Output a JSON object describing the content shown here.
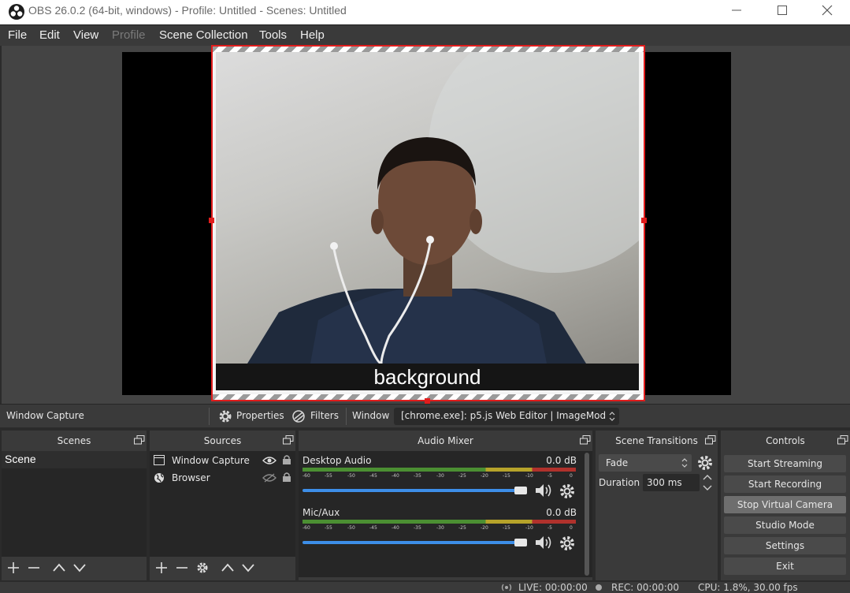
{
  "window": {
    "title": "OBS 26.0.2 (64-bit, windows) - Profile: Untitled - Scenes: Untitled",
    "app_icon": "obs-logo-icon",
    "controls": [
      "minimize-icon",
      "maximize-icon",
      "close-icon"
    ]
  },
  "menu": {
    "file": "File",
    "edit": "Edit",
    "view": "View",
    "profile": "Profile",
    "scene_collection": "Scene Collection",
    "tools": "Tools",
    "help": "Help"
  },
  "preview": {
    "overlay_text": "background",
    "selection_color": "#e11d1d"
  },
  "source_toolbar": {
    "selected_source": "Window Capture",
    "properties": "Properties",
    "filters": "Filters",
    "window_label": "Window",
    "window_value": "[chrome.exe]: p5.js Web Editor | ImageMod"
  },
  "scenes": {
    "title": "Scenes",
    "items": [
      "Scene"
    ]
  },
  "sources": {
    "title": "Sources",
    "items": [
      {
        "name": "Window Capture",
        "icon": "window-capture-icon",
        "visible": true,
        "locked": true
      },
      {
        "name": "Browser",
        "icon": "globe-icon",
        "visible": false,
        "locked": true
      }
    ]
  },
  "audio_mixer": {
    "title": "Audio Mixer",
    "ticks": [
      "-60",
      "-55",
      "-50",
      "-45",
      "-40",
      "-35",
      "-30",
      "-25",
      "-20",
      "-15",
      "-10",
      "-5",
      "0"
    ],
    "channels": [
      {
        "name": "Desktop Audio",
        "db": "0.0 dB",
        "volume": 1.0
      },
      {
        "name": "Mic/Aux",
        "db": "0.0 dB",
        "volume": 1.0
      }
    ]
  },
  "transitions": {
    "title": "Scene Transitions",
    "type": "Fade",
    "duration_label": "Duration",
    "duration_value": "300 ms"
  },
  "controls": {
    "title": "Controls",
    "start_streaming": "Start Streaming",
    "start_recording": "Start Recording",
    "stop_virtual_camera": "Stop Virtual Camera",
    "studio_mode": "Studio Mode",
    "settings": "Settings",
    "exit": "Exit"
  },
  "status": {
    "live": "LIVE: 00:00:00",
    "rec": "REC: 00:00:00",
    "cpu": "CPU: 1.8%, 30.00 fps"
  }
}
